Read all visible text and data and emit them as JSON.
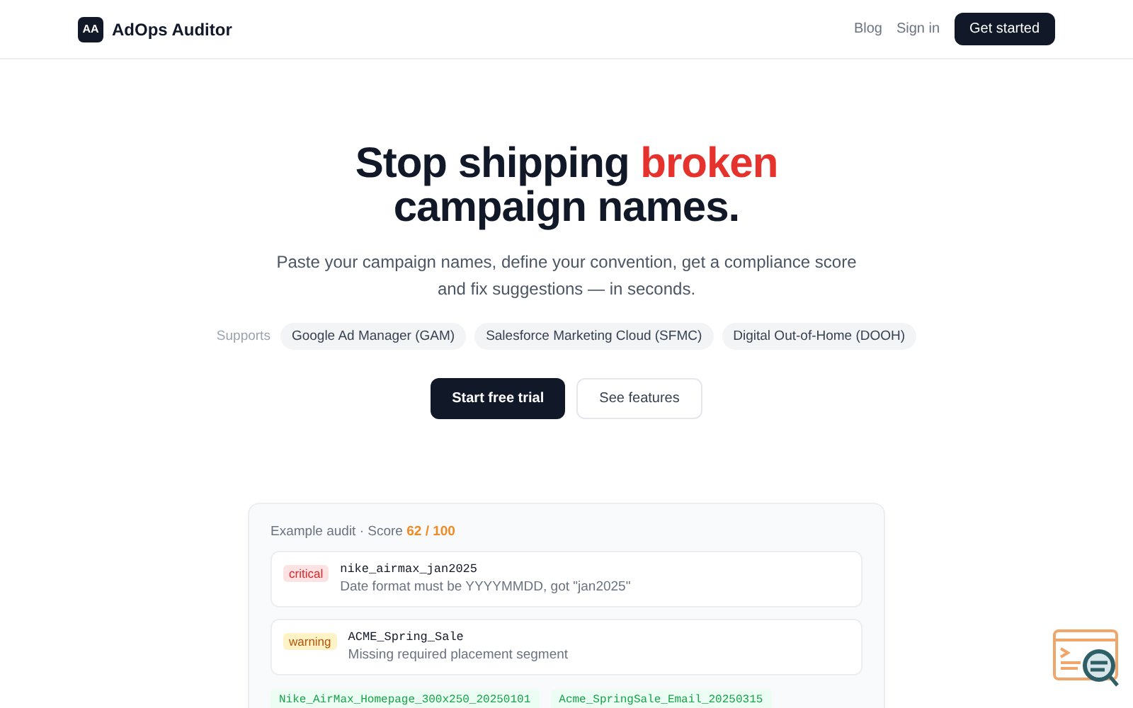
{
  "header": {
    "logo_mark": "AA",
    "brand": "AdOps Auditor",
    "nav": [
      "Blog",
      "Sign in"
    ],
    "cta": "Get started"
  },
  "hero": {
    "title_parts": [
      {
        "text": "Stop shipping ",
        "accent": false
      },
      {
        "text": "broken",
        "accent": true
      },
      {
        "text": " campaign names.",
        "accent": false
      }
    ],
    "subtitle": "Paste your campaign names, define your convention, get a compliance score and fix suggestions — in seconds.",
    "supports_label": "Supports",
    "platforms": [
      "Google Ad Manager (GAM)",
      "Salesforce Marketing Cloud (SFMC)",
      "Digital Out-of-Home (DOOH)"
    ],
    "buttons": [
      {
        "label": "Start free trial",
        "kind": "primary"
      },
      {
        "label": "See features",
        "kind": "secondary"
      }
    ]
  },
  "example_audit": {
    "label": "Example audit · Score ",
    "score": "62 / 100",
    "issues": [
      {
        "severity": "critical",
        "name": "nike_airmax_jan2025",
        "message": "Date format must be YYYYMMDD, got \"jan2025\""
      },
      {
        "severity": "warning",
        "name": "ACME_Spring_Sale",
        "message": "Missing required placement segment"
      }
    ],
    "valid_names": [
      "Nike_AirMax_Homepage_300x250_20250101",
      "Acme_SpringSale_Email_20250315"
    ]
  }
}
